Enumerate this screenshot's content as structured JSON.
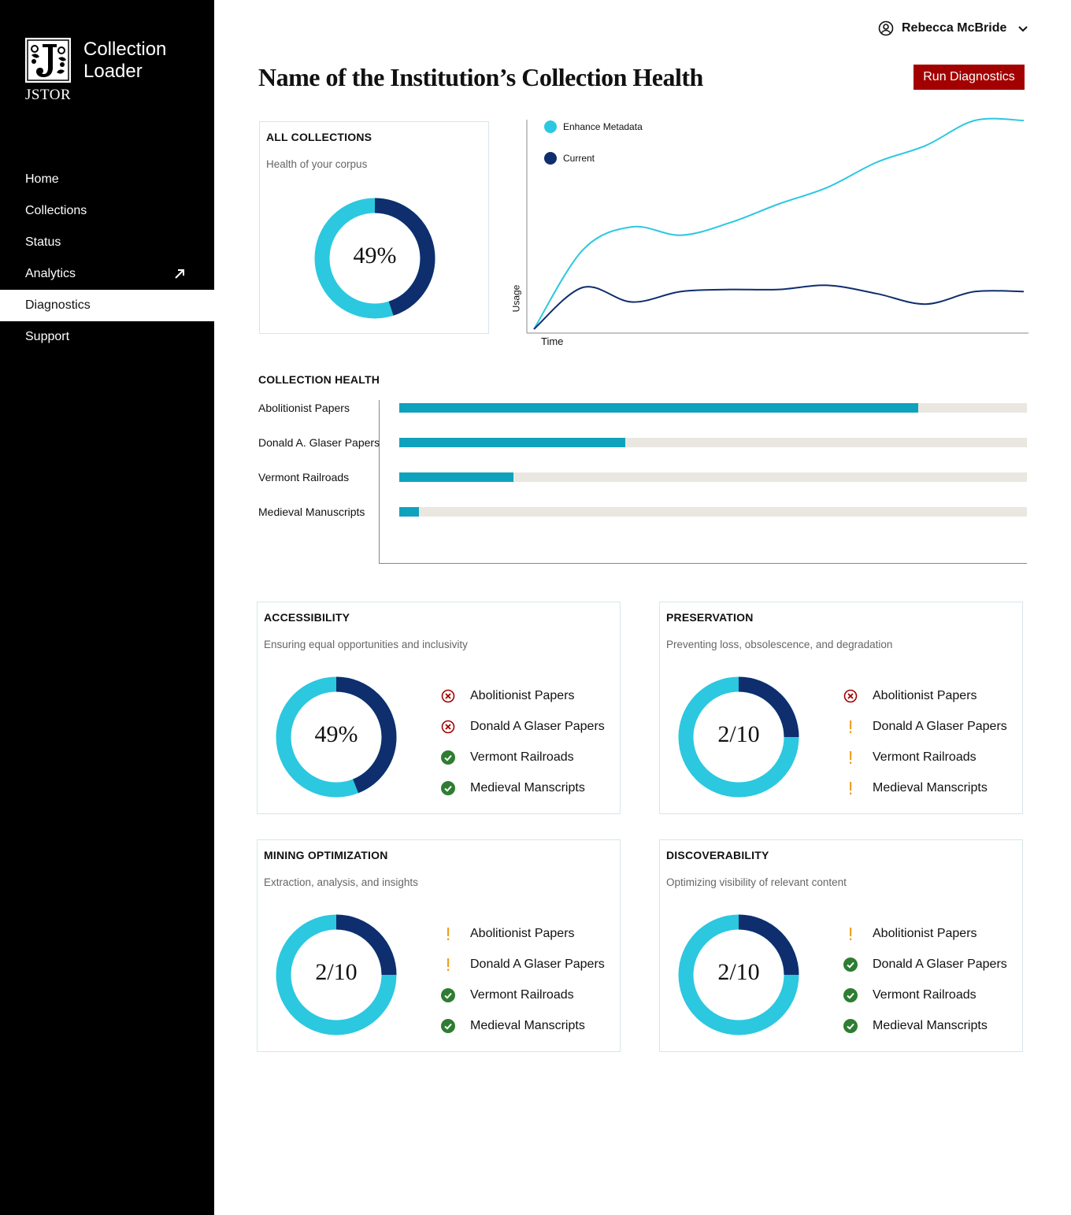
{
  "sidebar": {
    "app_name": "Collection Loader",
    "logo_word": "JSTOR",
    "nav": [
      {
        "label": "Home"
      },
      {
        "label": "Collections"
      },
      {
        "label": "Status"
      },
      {
        "label": "Analytics"
      },
      {
        "label": "Diagnostics",
        "active": true
      },
      {
        "label": "Support"
      }
    ]
  },
  "header": {
    "user_name": "Rebecca McBride",
    "title": "Name of the Institution’s Collection Health",
    "run_button": "Run Diagnostics"
  },
  "colors": {
    "accent_light": "#2bc8e0",
    "accent_dark": "#0f2e6e",
    "bar_fill": "#0fa2bd",
    "button": "#a30000",
    "error": "#a30000",
    "warning": "#f0a020",
    "success": "#2e7d32"
  },
  "all_collections": {
    "title": "ALL COLLECTIONS",
    "subtitle": "Health of your corpus",
    "value_text": "49%",
    "dark_fraction": 0.45
  },
  "usage_chart": {
    "legend": [
      "Enhance Metadata",
      "Current"
    ],
    "xlabel": "Time",
    "ylabel": "Usage"
  },
  "chart_data": {
    "type": "line",
    "xlabel": "Time",
    "ylabel": "Usage",
    "x": [
      0,
      1,
      2,
      3,
      4,
      5,
      6,
      7,
      8,
      9,
      10
    ],
    "series": [
      {
        "name": "Enhance Metadata",
        "values": [
          0,
          38,
          49,
          45,
          51,
          60,
          68,
          80,
          88,
          100,
          100
        ]
      },
      {
        "name": "Current",
        "values": [
          0,
          20,
          13,
          18,
          19,
          19,
          21,
          17,
          12,
          18,
          18
        ]
      }
    ]
  },
  "collection_health": {
    "title": "COLLECTION HEALTH",
    "bars": [
      {
        "label": "Abolitionist Papers",
        "value": 0.827
      },
      {
        "label": "Donald A. Glaser Papers",
        "value": 0.36
      },
      {
        "label": "Vermont Railroads",
        "value": 0.182
      },
      {
        "label": "Medieval Manuscripts",
        "value": 0.031
      }
    ]
  },
  "cards": [
    {
      "title": "ACCESSIBILITY",
      "subtitle": "Ensuring equal opportunities and inclusivity",
      "value_text": "49%",
      "dark_fraction": 0.44,
      "items": [
        {
          "label": "Abolitionist Papers",
          "status": "error"
        },
        {
          "label": "Donald A Glaser Papers",
          "status": "error"
        },
        {
          "label": "Vermont Railroads",
          "status": "success"
        },
        {
          "label": "Medieval Manscripts",
          "status": "success"
        }
      ]
    },
    {
      "title": "PRESERVATION",
      "subtitle": "Preventing loss, obsolescence, and degradation",
      "value_text": "2/10",
      "dark_fraction": 0.25,
      "items": [
        {
          "label": "Abolitionist Papers",
          "status": "error"
        },
        {
          "label": "Donald A Glaser Papers",
          "status": "warning"
        },
        {
          "label": "Vermont Railroads",
          "status": "warning"
        },
        {
          "label": "Medieval Manscripts",
          "status": "warning"
        }
      ]
    },
    {
      "title": "MINING OPTIMIZATION",
      "subtitle": "Extraction, analysis, and insights",
      "value_text": "2/10",
      "dark_fraction": 0.25,
      "items": [
        {
          "label": "Abolitionist Papers",
          "status": "warning"
        },
        {
          "label": "Donald A Glaser Papers",
          "status": "warning"
        },
        {
          "label": "Vermont Railroads",
          "status": "success"
        },
        {
          "label": "Medieval Manscripts",
          "status": "success"
        }
      ]
    },
    {
      "title": "DISCOVERABILITY",
      "subtitle": "Optimizing visibility of relevant content",
      "value_text": "2/10",
      "dark_fraction": 0.25,
      "items": [
        {
          "label": "Abolitionist Papers",
          "status": "warning"
        },
        {
          "label": "Donald A Glaser Papers",
          "status": "success"
        },
        {
          "label": "Vermont Railroads",
          "status": "success"
        },
        {
          "label": "Medieval Manscripts",
          "status": "success"
        }
      ]
    }
  ]
}
